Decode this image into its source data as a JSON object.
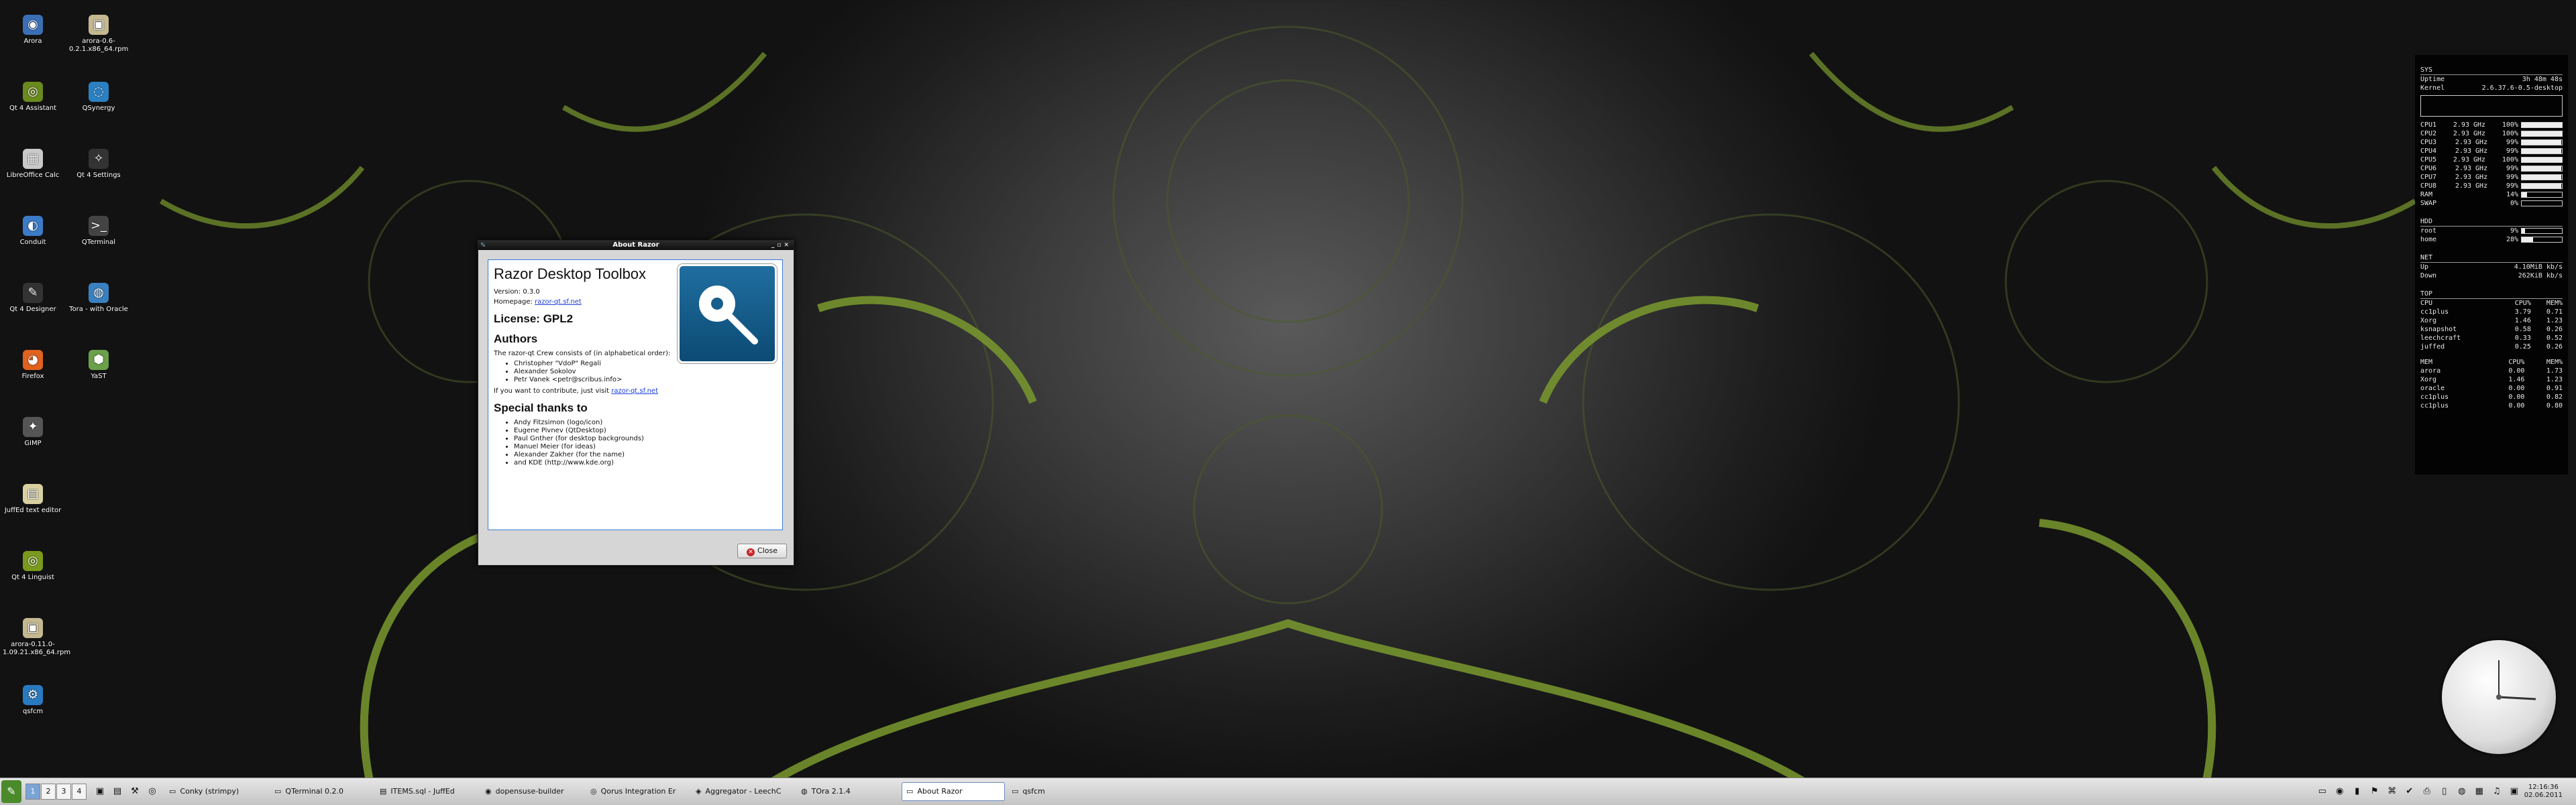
{
  "desktop_icons": [
    {
      "label": "Arora",
      "glyph": "globe-icon",
      "char": "◉",
      "color": "#3b6fb5"
    },
    {
      "label": "Qt 4 Assistant",
      "glyph": "assistant-icon",
      "char": "◎",
      "color": "#6a8a1e"
    },
    {
      "label": "LibreOffice Calc",
      "glyph": "calc-icon",
      "char": "▦",
      "color": "#c9c9c9"
    },
    {
      "label": "Conduit",
      "glyph": "sync-icon",
      "char": "◐",
      "color": "#3b7bc8"
    },
    {
      "label": "Qt 4 Designer",
      "glyph": "designer-icon",
      "char": "✎",
      "color": "#333333"
    },
    {
      "label": "Firefox",
      "glyph": "firefox-icon",
      "char": "◕",
      "color": "#e0621f"
    },
    {
      "label": "GIMP",
      "glyph": "gimp-icon",
      "char": "✦",
      "color": "#555555"
    },
    {
      "label": "JuffEd text editor",
      "glyph": "editor-icon",
      "char": "▤",
      "color": "#d8d0a0"
    },
    {
      "label": "Qt 4 Linguist",
      "glyph": "linguist-icon",
      "char": "◎",
      "color": "#7a9a1e"
    },
    {
      "label": "arora-0.11.0-1.09.21.x86_64.rpm",
      "glyph": "package-icon",
      "char": "▣",
      "color": "#c4b890"
    },
    {
      "label": "qsfcm",
      "glyph": "gear-icon",
      "char": "⚙",
      "color": "#2a7ac0"
    },
    {
      "label": "arora-0.6-0.2.1.x86_64.rpm",
      "glyph": "package-icon",
      "char": "▣",
      "color": "#c4b890"
    },
    {
      "label": "QSynergy",
      "glyph": "synergy-icon",
      "char": "◌",
      "color": "#2b80c2"
    },
    {
      "label": "Qt 4 Settings",
      "glyph": "settings-icon",
      "char": "✧",
      "color": "#333333"
    },
    {
      "label": "QTerminal",
      "glyph": "terminal-icon",
      "char": ">_",
      "color": "#444444"
    },
    {
      "label": "Tora - with Oracle",
      "glyph": "tora-icon",
      "char": "◍",
      "color": "#3a80c0"
    },
    {
      "label": "YaST",
      "glyph": "yast-icon",
      "char": "⬢",
      "color": "#6aa04a"
    }
  ],
  "dialog": {
    "title": "About Razor",
    "heading": "Razor Desktop Toolbox",
    "version": "Version: 0.3.0",
    "homepage_label": "Homepage: ",
    "homepage_link": "razor-qt.sf.net",
    "license": "License: GPL2",
    "authors_heading": "Authors",
    "authors_intro": "The razor-qt Crew consists of (in alphabetical order):",
    "authors": [
      "Christopher \"VdoP\" Regali",
      "Alexander Sokolov",
      "Petr Vanek <petr@scribus.info>"
    ],
    "contribute_text": "If you want to contribute, just visit ",
    "contribute_link": "razor-qt.sf.net",
    "thanks_heading": "Special thanks to",
    "thanks": [
      "Andy Fitzsimon (logo/icon)",
      "Eugene Pivnev (QtDesktop)",
      "Paul Gnther (for desktop backgrounds)",
      "Manuel Meier (for ideas)",
      "Alexander Zakher (for the name)",
      "and KDE (http://www.kde.org)"
    ],
    "close_label": "Close"
  },
  "conky": {
    "sys_label": "SYS",
    "uptime_label": "Uptime",
    "uptime": "3h 48m 48s",
    "kernel_label": "Kernel",
    "kernel": "2.6.37.6-0.5-desktop",
    "cpus": [
      {
        "name": "CPU1",
        "freq": "2.93 GHz",
        "pct": "100%",
        "level": 1.0
      },
      {
        "name": "CPU2",
        "freq": "2.93 GHz",
        "pct": "100%",
        "level": 1.0
      },
      {
        "name": "CPU3",
        "freq": "2.93 GHz",
        "pct": "99%",
        "level": 0.99
      },
      {
        "name": "CPU4",
        "freq": "2.93 GHz",
        "pct": "99%",
        "level": 0.99
      },
      {
        "name": "CPU5",
        "freq": "2.93 GHz",
        "pct": "100%",
        "level": 1.0
      },
      {
        "name": "CPU6",
        "freq": "2.93 GHz",
        "pct": "99%",
        "level": 0.99
      },
      {
        "name": "CPU7",
        "freq": "2.93 GHz",
        "pct": "99%",
        "level": 0.99
      },
      {
        "name": "CPU8",
        "freq": "2.93 GHz",
        "pct": "99%",
        "level": 0.99
      }
    ],
    "ram_label": "RAM",
    "ram": "14%",
    "ram_level": 0.14,
    "swap_label": "SWAP",
    "swap": "0%",
    "swap_level": 0.0,
    "hdd_label": "HDD",
    "disks": [
      {
        "name": "root",
        "pct": "9%",
        "level": 0.09
      },
      {
        "name": "home",
        "pct": "28%",
        "level": 0.28
      }
    ],
    "net_label": "NET",
    "up_label": "Up",
    "up": "4.10MiB kb/s",
    "down_label": "Down",
    "down": "262KiB kb/s",
    "top_label": "TOP",
    "top_cpu_header": [
      "CPU",
      "CPU%",
      "MEM%"
    ],
    "top_cpu": [
      [
        "cc1plus",
        "3.79",
        "0.71"
      ],
      [
        "Xorg",
        "1.46",
        "1.23"
      ],
      [
        "ksnapshot",
        "0.58",
        "0.26"
      ],
      [
        "leechcraft",
        "0.33",
        "0.52"
      ],
      [
        "juffed",
        "0.25",
        "0.26"
      ]
    ],
    "top_mem_header": [
      "MEM",
      "CPU%",
      "MEM%"
    ],
    "top_mem": [
      [
        "arora",
        "0.00",
        "1.73"
      ],
      [
        "Xorg",
        "1.46",
        "1.23"
      ],
      [
        "oracle",
        "0.00",
        "0.91"
      ],
      [
        "cc1plus",
        "0.00",
        "0.82"
      ],
      [
        "cc1plus",
        "0.00",
        "0.80"
      ]
    ]
  },
  "taskbar": {
    "pager": [
      "1",
      "2",
      "3",
      "4"
    ],
    "tasks": [
      {
        "label": "Conky (strimpy)",
        "icon": "▭"
      },
      {
        "label": "QTerminal 0.2.0",
        "icon": "▭"
      },
      {
        "label": "ITEMS.sql - JuffEd",
        "icon": "▤"
      },
      {
        "label": "dopensuse-builder",
        "icon": "◉"
      },
      {
        "label": "Qorus Integration Er",
        "icon": "◎"
      },
      {
        "label": "Aggregator - LeechC",
        "icon": "◈"
      },
      {
        "label": "TOra 2.1.4",
        "icon": "◍"
      },
      {
        "label": "About Razor",
        "icon": "▭",
        "active": true
      },
      {
        "label": "qsfcm",
        "icon": "▭"
      }
    ],
    "clock_time": "12:16:36",
    "clock_date": "02.06.2011"
  },
  "colors": {
    "accent": "#3a7bd5",
    "link": "#1a3fd8",
    "green": "#6e8f2e"
  }
}
